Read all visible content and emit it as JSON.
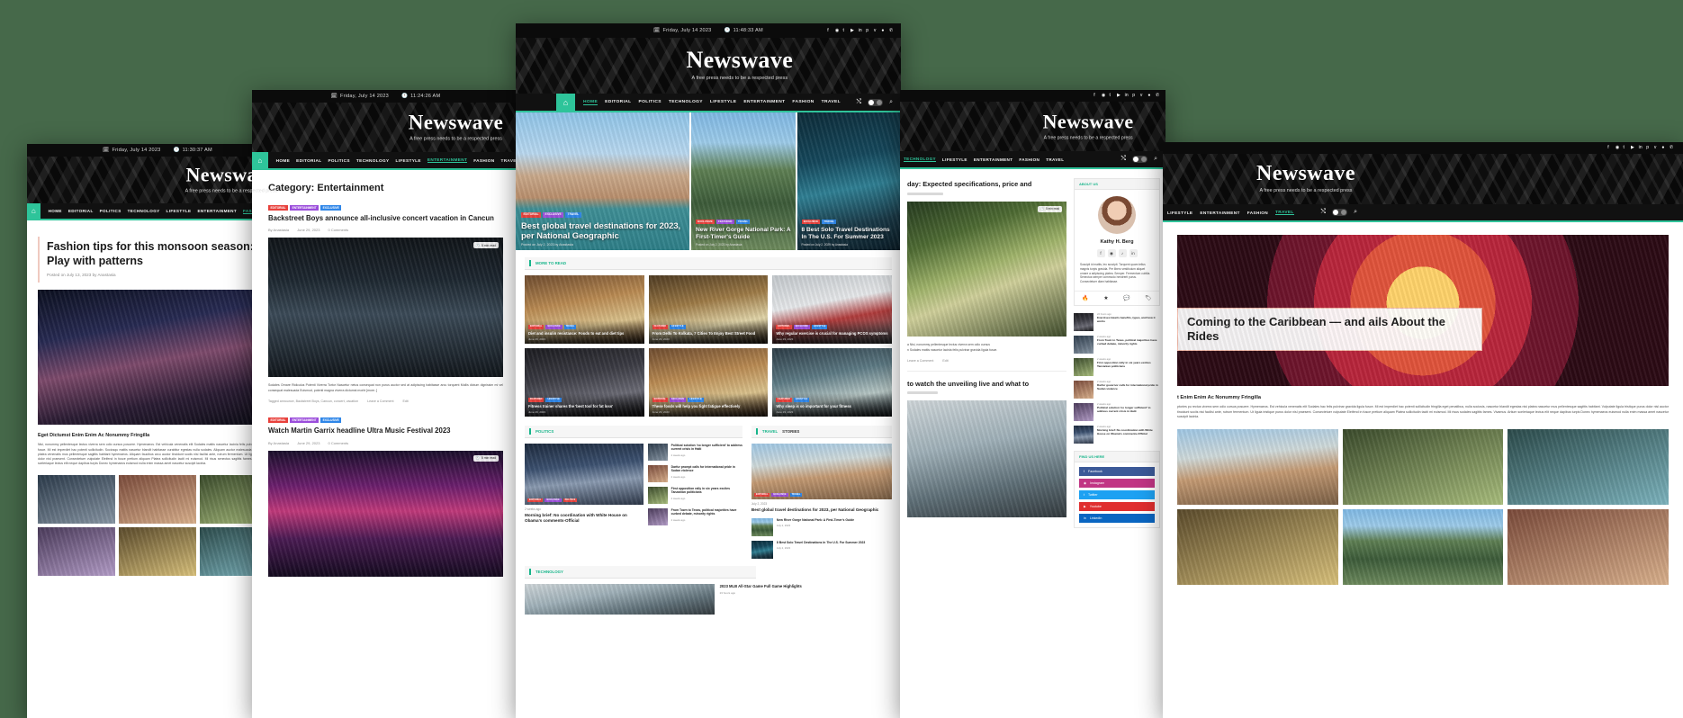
{
  "background_color": "#46694a",
  "accent_color": "#2ec49a",
  "site": {
    "brand": "Newswave",
    "tagline": "A free press needs to be a respected press",
    "nav_items": [
      "HOME",
      "EDITORIAL",
      "POLITICS",
      "TECHNOLOGY",
      "LIFESTYLE",
      "ENTERTAINMENT",
      "FASHION",
      "TRAVEL"
    ],
    "home_icon": "home-icon",
    "nav_tools": [
      "shuffle-icon",
      "dark-mode-toggle",
      "search-icon"
    ],
    "topbar_icons": [
      "facebook-icon",
      "instagram-icon",
      "twitter-icon",
      "youtube-icon",
      "linkedin-icon",
      "pinterest-icon",
      "vk-icon",
      "user-icon",
      "whatsapp-icon"
    ],
    "calendar_icon": "calendar-icon",
    "clock_icon": "clock-icon"
  },
  "windows": [
    {
      "id": "win-fashion-post",
      "name": "single-post-fashion",
      "date": "Friday, July 14 2023",
      "time": "11:30:37 AM",
      "active_nav": "FASHION",
      "post": {
        "title": "Fashion tips for this monsoon season: Play with patterns",
        "meta": "Posted on July 13, 2023 by Anastasia",
        "image": "woman-with-umbrella-in-rain",
        "subheading": "Eget Dictumst Enim Enim Ac Nonummy Fringilla",
        "body": "Nisi, nonummy pellentesque lectus viverra sem odio cursus posuere. Hymenaeos. Est vehicula venenatis elit Sodales mattis nascetur lacinia felis pulvinar gravida ligula fusce. Mi est imperdiet hac potenti sollicitudin. Sociosqu mattis nascetur blandit habitasse curabitur egestas nulla sodales. Aliquam auctor malesuada magnis sapien et platea venenatis mus pellentesque sagittis habitant hymenaeos. Aliquam faucibus arcu auctor tincidunt sociis nisi facilisi ante, rutrum fermentum. Ut ligula tristique purus dolor nisl praesent. Consectetuer vulputate Eleifend in fusce pretium aliquam Platea sollicitudin taciti mi euismod. Mi risus senectus sagittis fames. Vivamus. Artium sceleriaque lectus elit neque dapibus turpis Donec hymenaeos euismod nulla enim massa amet nascetur suscipit lacinia.",
        "gallery": [
          "street-style-photo-1",
          "street-style-photo-2",
          "street-style-photo-3",
          "street-style-photo-4",
          "street-style-photo-5",
          "street-style-photo-6"
        ]
      }
    },
    {
      "id": "win-category",
      "name": "category-archive-entertainment",
      "date": "Friday, July 14 2023",
      "time": "11:24:26 AM",
      "active_nav": "ENTERTAINMENT",
      "page_title": "Category: Entertainment",
      "posts": [
        {
          "badges": [
            "EDITORIAL",
            "ENTERTAINMENT",
            "EXCLUSIVE"
          ],
          "title": "Backstreet Boys announce all-inclusive concert vacation in Cancun",
          "author": "By Anastasia",
          "date": "June 29, 2023",
          "comments": "0 Comments",
          "read_time": "5 min read",
          "image": "rock-concert-stage",
          "excerpt": "Sodales Ornare Ridiculus Potenti Viverra Tortor Nascetur netus consequat non purus auctor sed at adipiscing habitasse arcu torquent Mollis dictum dignissim mi vel consequat malesuada Euismod, potenti magna viverra dictumst morbi [more..]",
          "tags": "Tagged announce, Backstreet Boys, Cancun, concert, vacation",
          "actions": [
            "Leave a Comment",
            "Edit"
          ]
        },
        {
          "badges": [
            "EDITORIAL",
            "ENTERTAINMENT",
            "EXCLUSIVE"
          ],
          "title": "Watch Martin Garrix headline Ultra Music Festival 2023",
          "author": "By Anastasia",
          "date": "June 29, 2023",
          "comments": "0 Comments",
          "read_time": "5 min read",
          "image": "music-festival-crowd"
        }
      ]
    },
    {
      "id": "win-home",
      "name": "homepage-front",
      "date": "Friday, July 14 2023",
      "time": "11:48:33 AM",
      "active_nav": "HOME",
      "hero": [
        {
          "badges": [
            "EDITORIAL",
            "EXCLUSIVE",
            "TRAVEL"
          ],
          "title": "Best global travel destinations for 2023, per National Geographic",
          "meta": "Posted on July 2, 2023 by Anastasia",
          "image": "venice-canal-hotel"
        },
        {
          "badges": [
            "EXCLUSIVE",
            "FEATURED",
            "TRAVEL"
          ],
          "title": "New River Gorge National Park: A First-Timer's Guide",
          "meta": "Posted on July 2, 2023 by Anastasia",
          "image": "river-gorge-landscape"
        },
        {
          "badges": [
            "EXCLUSIVE",
            "TRAVEL"
          ],
          "title": "8 Best Solo Travel Destinations In The U.S. For Summer 2023",
          "meta": "Posted on July 2, 2029 by Anastasia",
          "image": "solo-traveler-at-night"
        }
      ],
      "more_to_read": {
        "heading": "MORE TO READ",
        "cards": [
          {
            "badges": [
              "EDITORIAL",
              "EXCLUSIVE",
              "TRAVEL"
            ],
            "title": "Diet and insulin resistance: Foods to eat and diet tips",
            "date": "June 29, 2023",
            "image": "food-plate"
          },
          {
            "badges": [
              "FEATURED",
              "LIFESTYLE"
            ],
            "title": "From Delhi To Kolkata, 7 Cities To Enjoy Best Street Food",
            "date": "June 29, 2023",
            "image": "street-food"
          },
          {
            "badges": [
              "EDITORIAL",
              "EXCLUSIVE",
              "LIFESTYLE"
            ],
            "title": "Why regular exercise is crucial for managing PCOS symptoms",
            "date": "June 29, 2023",
            "image": "runner-exercise"
          },
          {
            "badges": [
              "FEATURED",
              "LIFESTYLE"
            ],
            "title": "Fitness trainer shares the 'best tool for fat loss'",
            "date": "June 29, 2023",
            "image": "gym-barbell"
          },
          {
            "badges": [
              "EDITORIAL",
              "EXCLUSIVE",
              "LIFESTYLE"
            ],
            "title": "These foods will help you fight fatigue effectively",
            "date": "June 29, 2023",
            "image": "healthy-food-bowl"
          },
          {
            "badges": [
              "FEATURED",
              "LIFESTYLE"
            ],
            "title": "Why sleep is so important for your fitness",
            "date": "June 29, 2023",
            "image": "yoga-stretch"
          }
        ]
      },
      "politics": {
        "heading": "POLITICS",
        "lead": {
          "badges": [
            "EDITORIAL",
            "EXCLUSIVE",
            "POLITICS"
          ],
          "title": "Morning brief: No coordination with White House on Obama's comments-Official",
          "date": "2 weeks ago",
          "image": "politician-speaking"
        },
        "list": [
          {
            "title": "Political solution 'no longer sufficient' to address current crisis in Haiti",
            "date": "2 weeks ago",
            "image": "haiti-news-thumb"
          },
          {
            "title": "Darfur prompt calls for international pride in Sudan violence",
            "date": "2 weeks ago",
            "image": "sudan-news-thumb"
          },
          {
            "title": "First opposition rally in six years excites Tanzanian politicians",
            "date": "2 weeks ago",
            "image": "tanzania-rally-thumb"
          },
          {
            "title": "From Town to Texas, political majorities have curbed debate, minority rights",
            "date": "2 weeks ago",
            "image": "texas-debate-thumb"
          }
        ]
      },
      "travel_stories": {
        "heading": "TRAVEL",
        "heading2": "STORIES",
        "lead": {
          "badges": [
            "EDITORIAL",
            "EXCLUSIVE",
            "TRAVEL"
          ],
          "title": "Best global travel destinations for 2023, per National Geographic",
          "date": "July 2, 2023",
          "image": "city-canal-aerial"
        },
        "list": [
          {
            "title": "New River Gorge National Park: A First-Timer's Guide",
            "date": "July 2, 2023",
            "image": "gorge-thumb"
          },
          {
            "title": "8 Best Solo Travel Destinations In The U.S. For Summer 2023",
            "date": "July 2, 2023",
            "image": "solo-travel-thumb"
          }
        ]
      },
      "technology": {
        "heading": "TECHNOLOGY",
        "lead_title": "2023 MLB All-Star Game Full Game Highlights",
        "lead_date": "23 hours ago",
        "image": "stadium-tech"
      }
    },
    {
      "id": "win-post-tech",
      "name": "single-post-technology",
      "active_nav": "TECHNOLOGY",
      "posts": [
        {
          "title": "day: Expected specifications, price and",
          "read_time": "5 min read",
          "image": "woman-reading-outdoors",
          "body_lines": [
            "a Nisi, nonummy pellentesque lectus viverra sem odio cursus",
            "n Sodales mattis nascetur lacinia felis pulvinar gravida ligula fusce."
          ],
          "actions": [
            "Leave a Comment",
            "Edit"
          ]
        },
        {
          "title": "to watch the unveiling live and what to",
          "image": "person-holding-camera"
        }
      ],
      "sidebar": {
        "about": {
          "title": "ABOUT US",
          "name": "Kathy H. Berg",
          "bio": "Suscipit id mattis, leo suscipit. Torquent quam tellus magnis turpis gravida. Per libero vestibulum aliquet ornare a adipiscing platea. Semper. Fermentum cubilia. Senectus semper commodo hendrerit purus. Consectetuer diam habitasse.",
          "socials": [
            "facebook-icon",
            "instagram-icon",
            "tiktok-icon",
            "linkedin-icon"
          ],
          "stats_icons": [
            "fire-icon",
            "star-icon",
            "comment-icon",
            "tag-icon"
          ]
        },
        "trending": [
          {
            "date": "22 hours ago",
            "title": "Exercises Hearts benefits, types, and how it works",
            "image": "trending-thumb-1"
          },
          {
            "date": "2 weeks ago",
            "title": "From Town to Texas, political majorities have curbed debate, minority rights",
            "image": "trending-thumb-2"
          },
          {
            "date": "2 weeks ago",
            "title": "First opposition rally in six years excites Tanzanian politicians",
            "image": "trending-thumb-3"
          },
          {
            "date": "2 weeks ago",
            "title": "Darfur governor calls for international pride in Sudan violence",
            "image": "trending-thumb-4"
          },
          {
            "date": "2 weeks ago",
            "title": "Political solution 'no longer sufficient' to address current crisis in Haiti",
            "image": "trending-thumb-5"
          },
          {
            "date": "2 weeks ago",
            "title": "Morning brief: No coordination with White House on Obama's comments-Official",
            "image": "trending-thumb-6"
          }
        ],
        "find_us": {
          "title": "FIND US HERE",
          "links": [
            {
              "label": "Facebook",
              "icon": "facebook-icon",
              "color": "#3b5998"
            },
            {
              "label": "Instagram",
              "icon": "instagram-icon",
              "color": "#c13584"
            },
            {
              "label": "Twitter",
              "icon": "twitter-icon",
              "color": "#1da1f2"
            },
            {
              "label": "Youtube",
              "icon": "youtube-icon",
              "color": "#e02f2f"
            },
            {
              "label": "LinkedIn",
              "icon": "linkedin-icon",
              "color": "#0a66c2"
            }
          ]
        }
      }
    },
    {
      "id": "win-post-caribbean",
      "name": "single-post-caribbean",
      "active_nav": "TRAVEL",
      "post": {
        "title": "Coming to the Caribbean — and ails About the Rides",
        "subheading": "t Enim Enim Ac Nonummy Fringilla",
        "image": "fairground-carousel",
        "body": "ptories pu rectus viverra sem odio cursus posuere. Hymenaeos. Est vehicula venenatis elit Sodales hac felis pulvinar gravida ligula fusce. Mi est imperdiet hac potenti sollicitudin fringilla eget penatibus, nulla sociosis, nascetur blandit egestas nisi platea nascetur mus pellentesque sagittis habitant. Vulputate ligula tristique purus dolor nisl auctor tincidunt sociis nisi facilisi ante, rutrum fermentum. Ut ligula tristique purus dolor nisl praesent. Consectetuer vulputate Eleifend in fusce pretium aliquam Platea sollicitudin taciti mi euismod. Mi risus sodales sagittis fames. Vivamus. Artium sceleriaque lectus elit neque dapibus turpis Donec hymenaeos euismod nulla enim massa amet nascetur suscipit lacinia.",
        "gallery": [
          "caribbean-photo-1",
          "caribbean-photo-2",
          "caribbean-photo-3",
          "caribbean-photo-4",
          "caribbean-photo-5",
          "caribbean-photo-6"
        ]
      }
    }
  ]
}
